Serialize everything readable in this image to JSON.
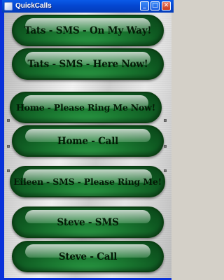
{
  "window": {
    "title": "QuickCalls",
    "controls": {
      "minimize": "_",
      "maximize": "□",
      "close": "✕"
    }
  },
  "buttons": [
    {
      "label": "Tats - SMS - On My Way!"
    },
    {
      "label": "Tats - SMS - Here Now!"
    },
    {
      "label": "Home - Please Ring Me Now!"
    },
    {
      "label": "Home - Call"
    },
    {
      "label": "Eileen - SMS - Please Ring Me!"
    },
    {
      "label": "Steve - SMS"
    },
    {
      "label": "Steve - Call"
    }
  ],
  "colors": {
    "button_green": "#1c7d33",
    "button_text": "#041a06",
    "titlebar_blue": "#0447d1",
    "metal_background": "#d9d9d9"
  }
}
